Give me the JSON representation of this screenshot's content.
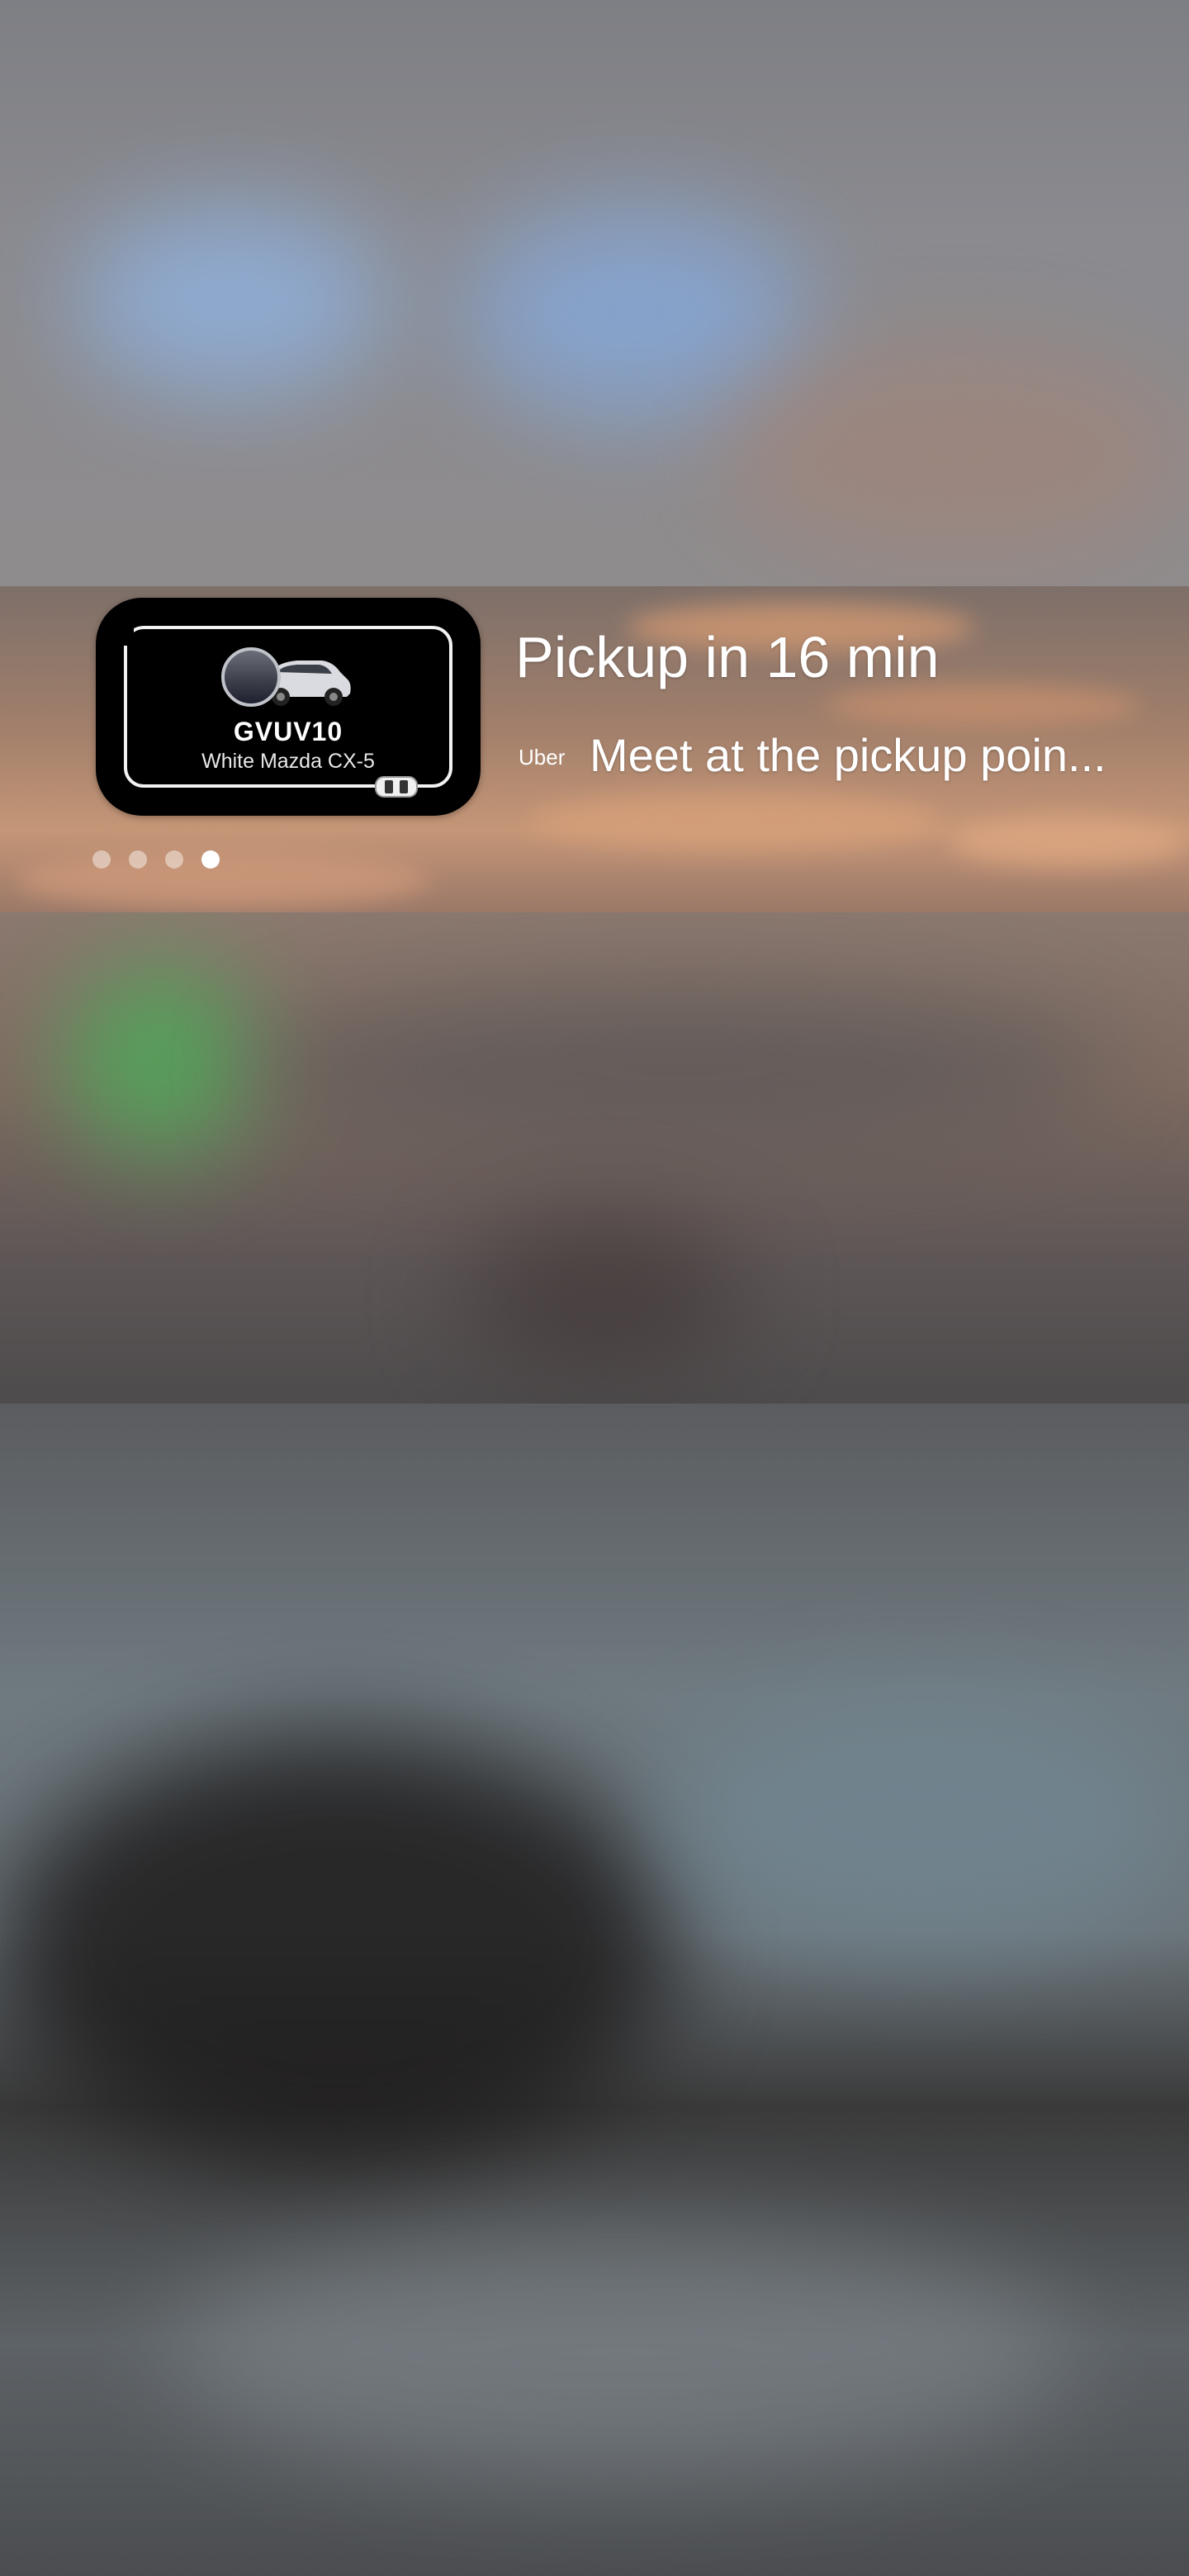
{
  "notification": {
    "app_name": "Uber",
    "title": "Pickup in 16 min",
    "subtitle": "Meet at the pickup poin...",
    "vehicle": {
      "plate": "GVUV10",
      "model": "White Mazda CX-5"
    },
    "page_indicator": {
      "total": 4,
      "active_index": 3
    }
  },
  "colors": {
    "card_background": "#000000",
    "text_primary": "#ffffff",
    "indicator_active": "#ffffff"
  }
}
